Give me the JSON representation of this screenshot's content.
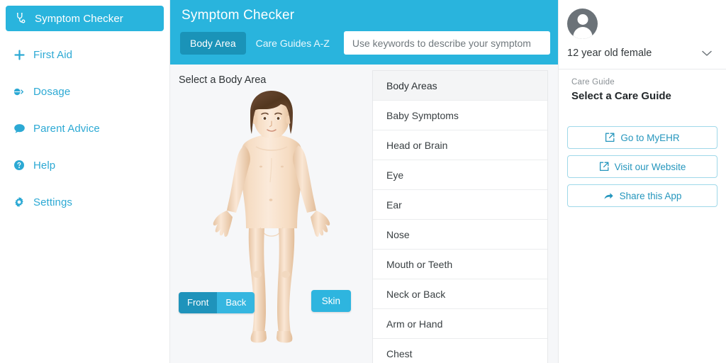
{
  "sidebar": {
    "items": [
      {
        "label": "Symptom Checker",
        "icon": "stethoscope-icon",
        "active": true
      },
      {
        "label": "First Aid",
        "icon": "plus-icon",
        "active": false
      },
      {
        "label": "Dosage",
        "icon": "pill-icon",
        "active": false
      },
      {
        "label": "Parent Advice",
        "icon": "chat-bubble-icon",
        "active": false
      },
      {
        "label": "Help",
        "icon": "question-circle-icon",
        "active": false
      },
      {
        "label": "Settings",
        "icon": "gear-icon",
        "active": false
      }
    ]
  },
  "header": {
    "title": "Symptom Checker",
    "tabs": [
      {
        "label": "Body Area",
        "active": true
      },
      {
        "label": "Care Guides A-Z",
        "active": false
      }
    ],
    "search": {
      "placeholder": "Use keywords to describe your symptom",
      "value": ""
    }
  },
  "body_panel": {
    "section_label": "Select a Body Area",
    "view_toggle": {
      "front_label": "Front",
      "back_label": "Back",
      "selected": "Front"
    },
    "skin_button_label": "Skin",
    "figure_alt": "child-body-front-illustration"
  },
  "area_list": {
    "header": "Body Areas",
    "items": [
      "Baby Symptoms",
      "Head or Brain",
      "Eye",
      "Ear",
      "Nose",
      "Mouth or Teeth",
      "Neck or Back",
      "Arm or Hand",
      "Chest"
    ]
  },
  "right_panel": {
    "patient": {
      "name": "12 year old female",
      "avatar": "user-avatar-icon",
      "chevron": "chevron-down-icon"
    },
    "care_guide": {
      "label": "Care Guide",
      "value": "Select a Care Guide"
    },
    "actions": [
      {
        "label": "Go to MyEHR",
        "icon": "external-link-icon"
      },
      {
        "label": "Visit our Website",
        "icon": "external-link-icon"
      },
      {
        "label": "Share this App",
        "icon": "share-arrow-icon"
      }
    ]
  },
  "colors": {
    "brand": "#29b4dd",
    "brand_dark": "#1a93b8",
    "accent_text": "#2ca9d4",
    "panel_bg": "#f6f7f9"
  }
}
